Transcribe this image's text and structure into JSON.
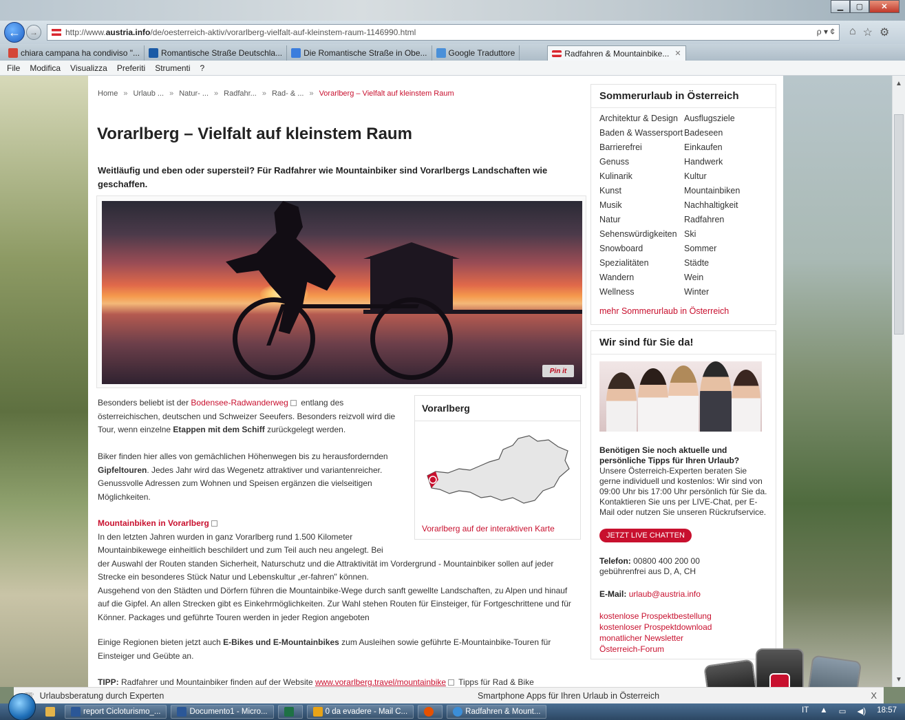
{
  "browser": {
    "url_prefix": "http://www.",
    "url_domain": "austria.info",
    "url_path": "/de/oesterreich-aktiv/vorarlberg-vielfalt-auf-kleinstem-raum-1146990.html",
    "addr_tools": "ρ ▾ ¢",
    "tabs": [
      {
        "label": "chiara campana ha condiviso \"...",
        "color": "#d44638"
      },
      {
        "label": "Romantische Straße Deutschla...",
        "color": "#1a5aa6"
      },
      {
        "label": "Die Romantische Straße in Obe...",
        "color": "#3b7ddd"
      },
      {
        "label": "Google Traduttore",
        "color": "#4a90d9"
      }
    ],
    "active_tab": "Radfahren & Mountainbike...",
    "menu": [
      "File",
      "Modifica",
      "Visualizza",
      "Preferiti",
      "Strumenti",
      "?"
    ]
  },
  "breadcrumb": {
    "items": [
      "Home",
      "Urlaub ...",
      "Natur- ...",
      "Radfahr...",
      "Rad- & ..."
    ],
    "sep": "»",
    "current": "Vorarlberg – Vielfalt auf kleinstem Raum"
  },
  "article": {
    "title": "Vorarlberg – Vielfalt auf kleinstem Raum",
    "lead": "Weitläufig und eben oder supersteil? Für Radfahrer wie Mountainbiker sind Vorarlbergs Landschaften wie geschaffen.",
    "pinit": "Pin it",
    "p1_a": "Besonders beliebt ist der ",
    "p1_link": "Bodensee-Radwanderweg",
    "p1_b": " entlang des österreichischen, deutschen und Schweizer Seeufers. Besonders reizvoll wird die Tour, wenn einzelne ",
    "p1_bold": "Etappen mit dem Schiff",
    "p1_c": " zurückgelegt werden.",
    "p2_a": "Biker finden hier alles von gemächlichen Höhenwegen bis zu herausfordernden ",
    "p2_bold": "Gipfeltouren",
    "p2_b": ". Jedes Jahr wird das Wegenetz attraktiver und variantenreicher. Genussvolle Adressen zum Wohnen und Speisen ergänzen die vielseitigen Möglichkeiten.",
    "sub1": "Mountainbiken in Vorarlberg",
    "p3_line1": "In den letzten Jahren wurden in ganz Vorarlberg rund 1.500 Kilometer",
    "p3_line2": "Mountainbikewege einheitlich beschildert und zum Teil auch neu angelegt. Bei",
    "p3_rest": "der Auswahl der Routen standen Sicherheit, Naturschutz und die Attraktivität im Vordergrund - Mountainbiker sollen auf jeder Strecke ein besonderes Stück Natur und Lebenskultur „er-fahren\" können.",
    "p3_b": "Ausgehend von den Städten und Dörfern führen die Mountainbike-Wege durch sanft gewellte Landschaften, zu Alpen und hinauf auf die Gipfel. An allen Strecken gibt es Einkehrmöglichkeiten. Zur Wahl stehen Routen für Einsteiger, für Fortgeschrittene und für Könner. Packages und geführte Touren werden in jeder Region angeboten",
    "p4_a": "Einige Regionen bieten jetzt auch ",
    "p4_bold": "E-Bikes und E-Mountainbikes",
    "p4_b": " zum Ausleihen sowie geführte E-Mountainbike-Touren für Einsteiger und Geübte an.",
    "tipp_label": "TIPP:",
    "tipp_a": " Radfahrer und Mountainbiker finden auf der Website ",
    "tipp_link": "www.vorarlberg.travel/mountainbike",
    "tipp_b": " Tipps für Rad & Bike"
  },
  "mapbox": {
    "title": "Vorarlberg",
    "link": "Vorarlberg auf der interaktiven Karte"
  },
  "summer_box": {
    "title": "Sommerurlaub in Österreich",
    "topics": [
      "Architektur & Design",
      "Ausflugsziele",
      "Baden & Wassersport",
      "Badeseen",
      "Barrierefrei",
      "Einkaufen",
      "Genuss",
      "Handwerk",
      "Kulinarik",
      "Kultur",
      "Kunst",
      "Mountainbiken",
      "Musik",
      "Nachhaltigkeit",
      "Natur",
      "Radfahren",
      "Sehenswürdigkeiten",
      "Ski",
      "Snowboard",
      "Sommer",
      "Spezialitäten",
      "Städte",
      "Wandern",
      "Wein",
      "Wellness",
      "Winter"
    ],
    "more": "mehr Sommerurlaub in Österreich"
  },
  "contact_box": {
    "title": "Wir sind für Sie da!",
    "heading": "Benötigen Sie noch aktuelle und persönliche Tipps für Ihren Urlaub?",
    "text": "Unsere Österreich-Experten beraten Sie gerne individuell und kostenlos: Wir sind von 09:00 Uhr bis 17:00 Uhr persönlich für Sie da. Kontaktieren Sie uns per LIVE-Chat, per E-Mail oder nutzen Sie unseren Rückrufservice.",
    "chat_button": "JETZT LIVE CHATTEN",
    "phone_label": "Telefon:",
    "phone": "00800 400 200 00",
    "phone_note": "gebührenfrei aus D, A, CH",
    "email_label": "E-Mail:",
    "email": "urlaub@austria.info",
    "links": [
      "kostenlose Prospektbestellung",
      "kostenloser Prospektdownload",
      "monatlicher Newsletter",
      "Österreich-Forum"
    ]
  },
  "bottom_bar": {
    "left": "Urlaubsberatung durch Experten",
    "right": "Smartphone Apps für Ihren Urlaub in Österreich",
    "close": "X"
  },
  "taskbar": {
    "items": [
      {
        "label": "report Cicloturismo_...",
        "color": "#2b5797"
      },
      {
        "label": "Documento1 - Micro...",
        "color": "#2b5797"
      },
      {
        "label": "",
        "color": "#1e7145"
      },
      {
        "label": "0 da evadere - Mail C...",
        "color": "#e8a317"
      },
      {
        "label": "",
        "color": "#e65100"
      },
      {
        "label": "Radfahren & Mount...",
        "color": "#3b8ed8"
      }
    ],
    "lang": "IT",
    "time": "18:57"
  }
}
